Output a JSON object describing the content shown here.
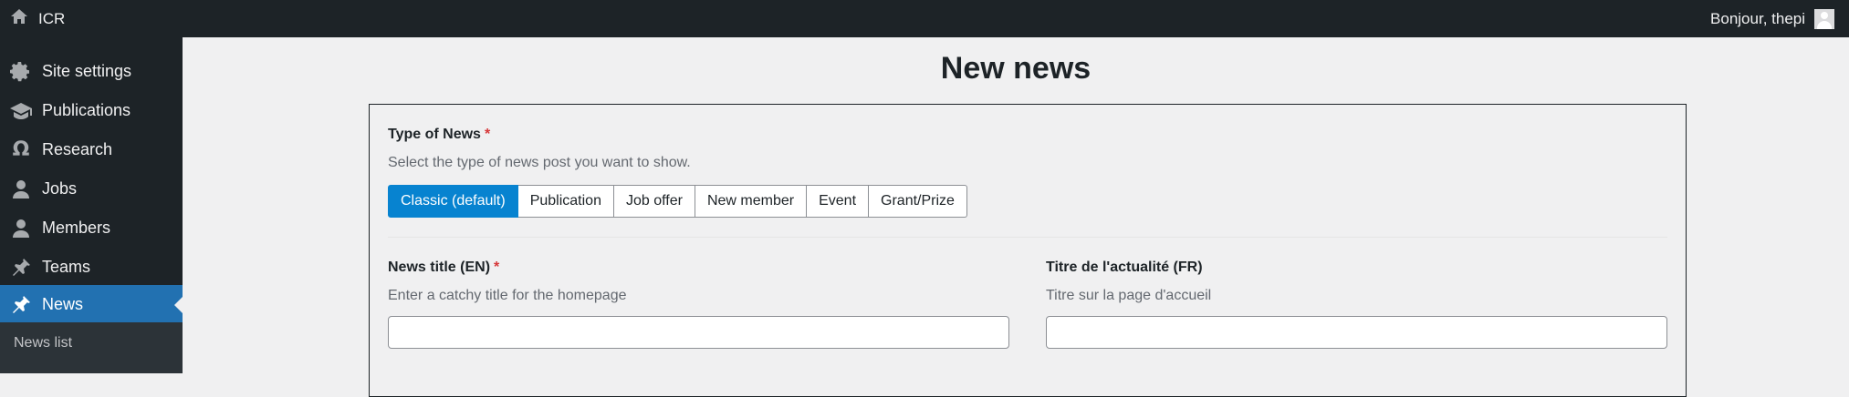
{
  "adminbar": {
    "site_name": "ICR",
    "greeting": "Bonjour, thepi"
  },
  "sidebar": {
    "items": [
      {
        "label": "Site settings",
        "icon": "gear-icon"
      },
      {
        "label": "Publications",
        "icon": "graduation-cap-icon"
      },
      {
        "label": "Research",
        "icon": "omega-icon"
      },
      {
        "label": "Jobs",
        "icon": "user-icon"
      },
      {
        "label": "Members",
        "icon": "user-icon"
      },
      {
        "label": "Teams",
        "icon": "pin-icon"
      },
      {
        "label": "News",
        "icon": "pin-icon",
        "active": true
      }
    ],
    "submenu": {
      "label": "News list"
    }
  },
  "main": {
    "title": "New news",
    "type_field": {
      "label": "Type of News",
      "required_mark": "*",
      "description": "Select the type of news post you want to show.",
      "options": [
        "Classic (default)",
        "Publication",
        "Job offer",
        "New member",
        "Event",
        "Grant/Prize"
      ],
      "selected": "Classic (default)"
    },
    "title_en": {
      "label": "News title (EN)",
      "required_mark": "*",
      "description": "Enter a catchy title for the homepage",
      "value": ""
    },
    "title_fr": {
      "label": "Titre de l'actualité (FR)",
      "description": "Titre sur la page d'accueil",
      "value": ""
    }
  },
  "colors": {
    "adminbar_bg": "#1d2327",
    "active_menu": "#2271b1",
    "selected_option": "#0783d0",
    "required": "#d63638"
  }
}
